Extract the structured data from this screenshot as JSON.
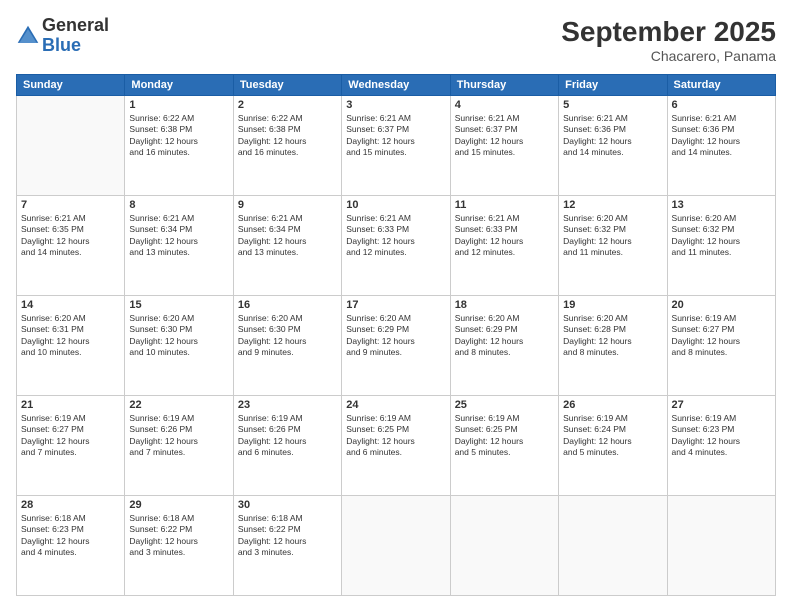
{
  "logo": {
    "general": "General",
    "blue": "Blue"
  },
  "header": {
    "month": "September 2025",
    "location": "Chacarero, Panama"
  },
  "weekdays": [
    "Sunday",
    "Monday",
    "Tuesday",
    "Wednesday",
    "Thursday",
    "Friday",
    "Saturday"
  ],
  "weeks": [
    [
      {
        "day": "",
        "info": ""
      },
      {
        "day": "1",
        "info": "Sunrise: 6:22 AM\nSunset: 6:38 PM\nDaylight: 12 hours\nand 16 minutes."
      },
      {
        "day": "2",
        "info": "Sunrise: 6:22 AM\nSunset: 6:38 PM\nDaylight: 12 hours\nand 16 minutes."
      },
      {
        "day": "3",
        "info": "Sunrise: 6:21 AM\nSunset: 6:37 PM\nDaylight: 12 hours\nand 15 minutes."
      },
      {
        "day": "4",
        "info": "Sunrise: 6:21 AM\nSunset: 6:37 PM\nDaylight: 12 hours\nand 15 minutes."
      },
      {
        "day": "5",
        "info": "Sunrise: 6:21 AM\nSunset: 6:36 PM\nDaylight: 12 hours\nand 14 minutes."
      },
      {
        "day": "6",
        "info": "Sunrise: 6:21 AM\nSunset: 6:36 PM\nDaylight: 12 hours\nand 14 minutes."
      }
    ],
    [
      {
        "day": "7",
        "info": "Sunrise: 6:21 AM\nSunset: 6:35 PM\nDaylight: 12 hours\nand 14 minutes."
      },
      {
        "day": "8",
        "info": "Sunrise: 6:21 AM\nSunset: 6:34 PM\nDaylight: 12 hours\nand 13 minutes."
      },
      {
        "day": "9",
        "info": "Sunrise: 6:21 AM\nSunset: 6:34 PM\nDaylight: 12 hours\nand 13 minutes."
      },
      {
        "day": "10",
        "info": "Sunrise: 6:21 AM\nSunset: 6:33 PM\nDaylight: 12 hours\nand 12 minutes."
      },
      {
        "day": "11",
        "info": "Sunrise: 6:21 AM\nSunset: 6:33 PM\nDaylight: 12 hours\nand 12 minutes."
      },
      {
        "day": "12",
        "info": "Sunrise: 6:20 AM\nSunset: 6:32 PM\nDaylight: 12 hours\nand 11 minutes."
      },
      {
        "day": "13",
        "info": "Sunrise: 6:20 AM\nSunset: 6:32 PM\nDaylight: 12 hours\nand 11 minutes."
      }
    ],
    [
      {
        "day": "14",
        "info": "Sunrise: 6:20 AM\nSunset: 6:31 PM\nDaylight: 12 hours\nand 10 minutes."
      },
      {
        "day": "15",
        "info": "Sunrise: 6:20 AM\nSunset: 6:30 PM\nDaylight: 12 hours\nand 10 minutes."
      },
      {
        "day": "16",
        "info": "Sunrise: 6:20 AM\nSunset: 6:30 PM\nDaylight: 12 hours\nand 9 minutes."
      },
      {
        "day": "17",
        "info": "Sunrise: 6:20 AM\nSunset: 6:29 PM\nDaylight: 12 hours\nand 9 minutes."
      },
      {
        "day": "18",
        "info": "Sunrise: 6:20 AM\nSunset: 6:29 PM\nDaylight: 12 hours\nand 8 minutes."
      },
      {
        "day": "19",
        "info": "Sunrise: 6:20 AM\nSunset: 6:28 PM\nDaylight: 12 hours\nand 8 minutes."
      },
      {
        "day": "20",
        "info": "Sunrise: 6:19 AM\nSunset: 6:27 PM\nDaylight: 12 hours\nand 8 minutes."
      }
    ],
    [
      {
        "day": "21",
        "info": "Sunrise: 6:19 AM\nSunset: 6:27 PM\nDaylight: 12 hours\nand 7 minutes."
      },
      {
        "day": "22",
        "info": "Sunrise: 6:19 AM\nSunset: 6:26 PM\nDaylight: 12 hours\nand 7 minutes."
      },
      {
        "day": "23",
        "info": "Sunrise: 6:19 AM\nSunset: 6:26 PM\nDaylight: 12 hours\nand 6 minutes."
      },
      {
        "day": "24",
        "info": "Sunrise: 6:19 AM\nSunset: 6:25 PM\nDaylight: 12 hours\nand 6 minutes."
      },
      {
        "day": "25",
        "info": "Sunrise: 6:19 AM\nSunset: 6:25 PM\nDaylight: 12 hours\nand 5 minutes."
      },
      {
        "day": "26",
        "info": "Sunrise: 6:19 AM\nSunset: 6:24 PM\nDaylight: 12 hours\nand 5 minutes."
      },
      {
        "day": "27",
        "info": "Sunrise: 6:19 AM\nSunset: 6:23 PM\nDaylight: 12 hours\nand 4 minutes."
      }
    ],
    [
      {
        "day": "28",
        "info": "Sunrise: 6:18 AM\nSunset: 6:23 PM\nDaylight: 12 hours\nand 4 minutes."
      },
      {
        "day": "29",
        "info": "Sunrise: 6:18 AM\nSunset: 6:22 PM\nDaylight: 12 hours\nand 3 minutes."
      },
      {
        "day": "30",
        "info": "Sunrise: 6:18 AM\nSunset: 6:22 PM\nDaylight: 12 hours\nand 3 minutes."
      },
      {
        "day": "",
        "info": ""
      },
      {
        "day": "",
        "info": ""
      },
      {
        "day": "",
        "info": ""
      },
      {
        "day": "",
        "info": ""
      }
    ]
  ]
}
